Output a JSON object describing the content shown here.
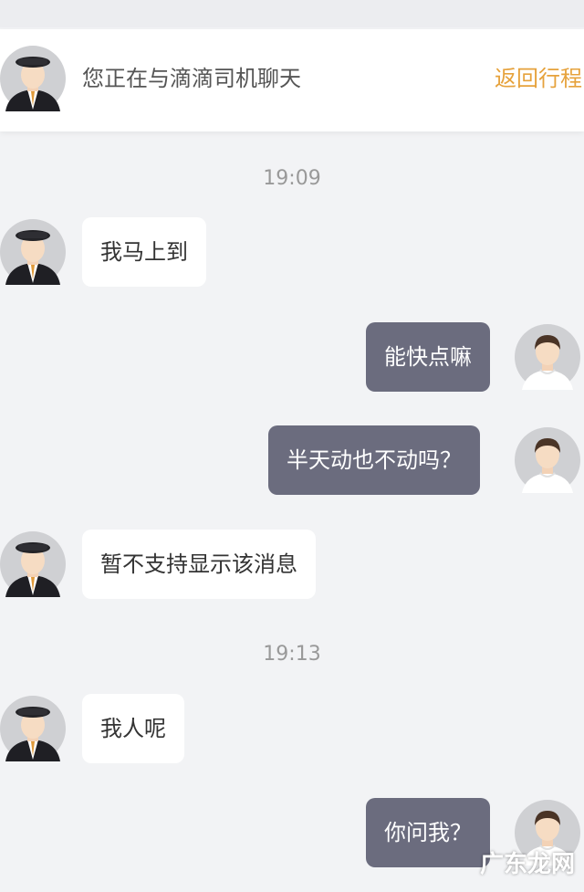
{
  "header": {
    "title": "您正在与滴滴司机聊天",
    "back_label": "返回行程"
  },
  "timestamps": [
    "19:09",
    "19:13"
  ],
  "messages": [
    {
      "side": "left",
      "text": "我马上到"
    },
    {
      "side": "right",
      "text": "能快点嘛"
    },
    {
      "side": "right",
      "text": "半天动也不动吗？"
    },
    {
      "side": "left",
      "text": "暂不支持显示该消息"
    },
    {
      "side": "left",
      "text": "我人呢"
    },
    {
      "side": "right",
      "text": "你问我？"
    }
  ],
  "avatars": {
    "driver_icon": "driver-avatar",
    "user_icon": "user-avatar"
  },
  "colors": {
    "accent": "#e6a23c",
    "outgoing_bubble": "#6b6c7e",
    "incoming_bubble": "#ffffff",
    "background": "#f2f3f5"
  },
  "watermark": "广东龙网"
}
